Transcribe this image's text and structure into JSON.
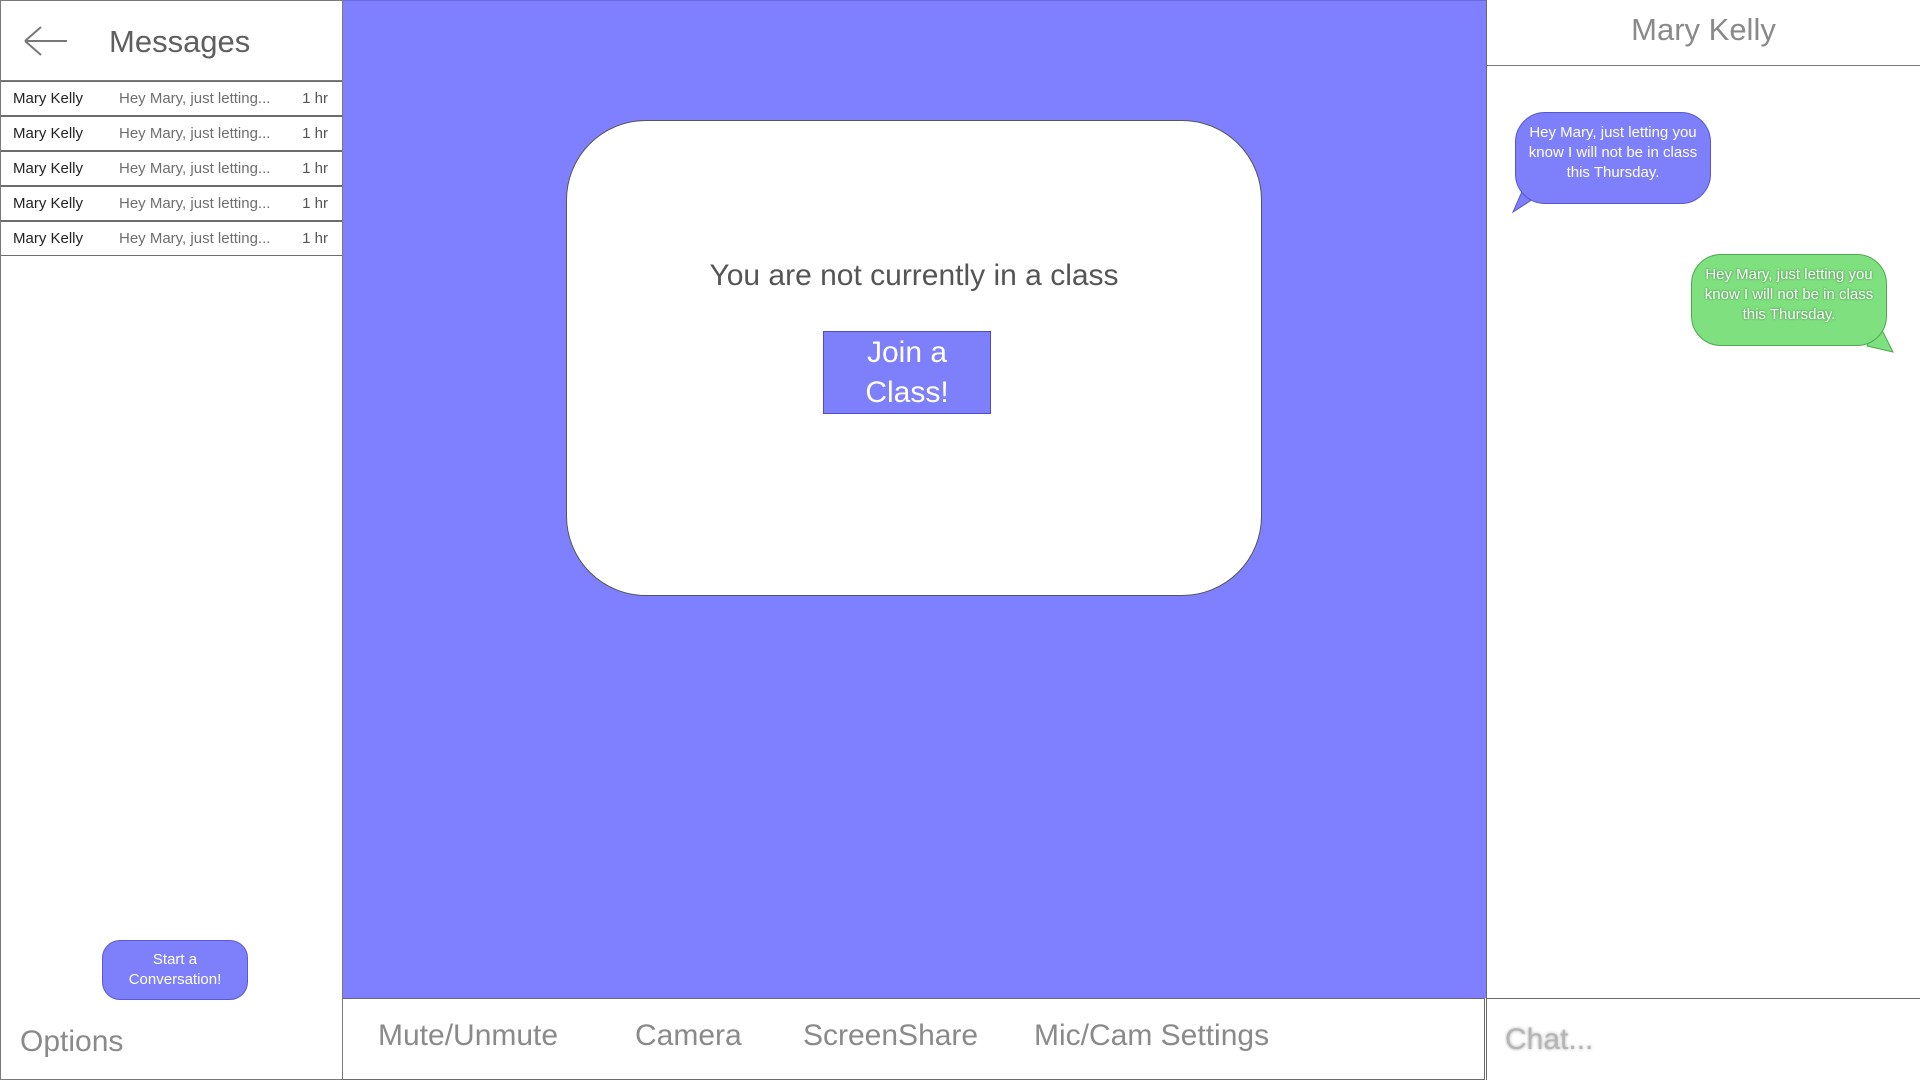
{
  "sidebar": {
    "title": "Messages",
    "conversations": [
      {
        "name": "Mary Kelly",
        "preview": "Hey Mary, just letting...",
        "time": "1 hr"
      },
      {
        "name": "Mary Kelly",
        "preview": "Hey Mary, just letting...",
        "time": "1 hr"
      },
      {
        "name": "Mary Kelly",
        "preview": "Hey Mary, just letting...",
        "time": "1 hr"
      },
      {
        "name": "Mary Kelly",
        "preview": "Hey Mary, just letting...",
        "time": "1 hr"
      },
      {
        "name": "Mary Kelly",
        "preview": "Hey Mary, just letting...",
        "time": "1 hr"
      }
    ],
    "start_conversation_line1": "Start a",
    "start_conversation_line2": "Conversation!",
    "options_label": "Options"
  },
  "class_area": {
    "status_message": "You are not currently in a class",
    "join_line1": "Join a",
    "join_line2": "Class!"
  },
  "toolbar": {
    "mute_label": "Mute/Unmute",
    "camera_label": "Camera",
    "screenshare_label": "ScreenShare",
    "settings_label": "Mic/Cam Settings"
  },
  "chat": {
    "contact_name": "Mary Kelly",
    "messages": [
      {
        "direction": "incoming",
        "text": "Hey Mary, just letting you know I will not be in class this Thursday."
      },
      {
        "direction": "outgoing",
        "text": "Hey Mary, just letting you know I will not be in class this Thursday."
      }
    ],
    "input_placeholder": "Chat..."
  },
  "colors": {
    "accent_purple": "#7f80ff",
    "outgoing_green": "#7ee07e"
  },
  "icons": {
    "back": "arrow-left-icon"
  }
}
